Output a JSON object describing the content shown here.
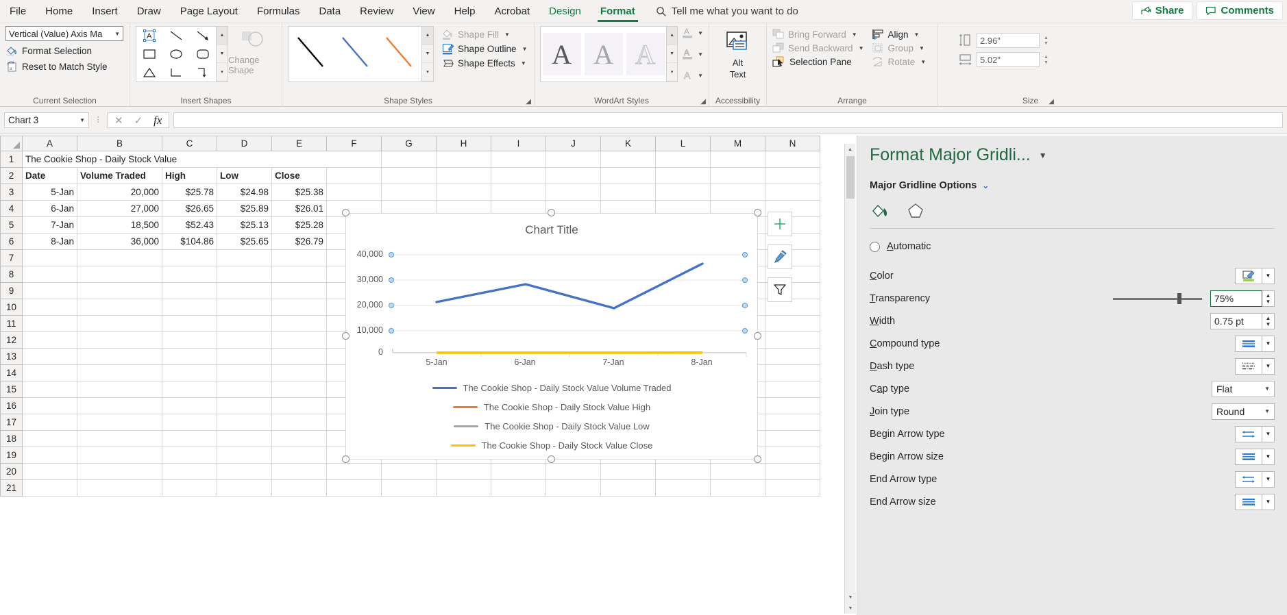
{
  "ribbon": {
    "tabs": [
      {
        "label": "File",
        "state": "normal"
      },
      {
        "label": "Home",
        "state": "normal"
      },
      {
        "label": "Insert",
        "state": "normal"
      },
      {
        "label": "Draw",
        "state": "normal"
      },
      {
        "label": "Page Layout",
        "state": "normal"
      },
      {
        "label": "Formulas",
        "state": "normal"
      },
      {
        "label": "Data",
        "state": "normal"
      },
      {
        "label": "Review",
        "state": "normal"
      },
      {
        "label": "View",
        "state": "normal"
      },
      {
        "label": "Help",
        "state": "normal"
      },
      {
        "label": "Acrobat",
        "state": "normal"
      },
      {
        "label": "Design",
        "state": "context"
      },
      {
        "label": "Format",
        "state": "active"
      }
    ],
    "tell_me": "Tell me what you want to do",
    "share": "Share",
    "comments": "Comments",
    "groups": {
      "current_selection": {
        "label": "Current Selection",
        "selection_value": "Vertical (Value) Axis Ma",
        "format_selection": "Format Selection",
        "reset_to_match_style": "Reset to Match Style"
      },
      "insert_shapes": {
        "label": "Insert Shapes",
        "change_shape": "Change Shape"
      },
      "shape_styles": {
        "label": "Shape Styles",
        "shape_fill": "Shape Fill",
        "shape_outline": "Shape Outline",
        "shape_effects": "Shape Effects"
      },
      "wordart_styles": {
        "label": "WordArt Styles",
        "sample": "A"
      },
      "accessibility": {
        "label": "Accessibility",
        "alt_text_line1": "Alt",
        "alt_text_line2": "Text"
      },
      "arrange": {
        "label": "Arrange",
        "bring_forward": "Bring Forward",
        "send_backward": "Send Backward",
        "selection_pane": "Selection Pane",
        "align": "Align",
        "group": "Group",
        "rotate": "Rotate"
      },
      "size": {
        "label": "Size",
        "height": "2.96\"",
        "width": "5.02\""
      }
    }
  },
  "formula_bar": {
    "name_box": "Chart 3",
    "formula_value": ""
  },
  "sheet": {
    "columns": [
      "A",
      "B",
      "C",
      "D",
      "E",
      "F",
      "G",
      "H",
      "I",
      "J",
      "K",
      "L",
      "M",
      "N"
    ],
    "rows": [
      "1",
      "2",
      "3",
      "4",
      "5",
      "6",
      "7",
      "8",
      "9",
      "10",
      "11",
      "12",
      "13",
      "14",
      "15",
      "16",
      "17",
      "18",
      "19",
      "20",
      "21"
    ],
    "title_cell": "The Cookie Shop - Daily Stock Value",
    "headers": [
      "Date",
      "Volume Traded",
      "High",
      "Low",
      "Close"
    ],
    "data": [
      [
        "5-Jan",
        "20,000",
        "$25.78",
        "$24.98",
        "$25.38"
      ],
      [
        "6-Jan",
        "27,000",
        "$26.65",
        "$25.89",
        "$26.01"
      ],
      [
        "7-Jan",
        "18,500",
        "$52.43",
        "$25.13",
        "$25.28"
      ],
      [
        "8-Jan",
        "36,000",
        "$104.86",
        "$25.65",
        "$26.79"
      ]
    ]
  },
  "chart_data": {
    "type": "line",
    "title": "Chart Title",
    "xlabel": "",
    "ylabel": "",
    "categories": [
      "5-Jan",
      "6-Jan",
      "7-Jan",
      "8-Jan"
    ],
    "yticks": [
      "0",
      "10,000",
      "20,000",
      "30,000",
      "40,000"
    ],
    "ylim": [
      0,
      40000
    ],
    "grid": true,
    "legend_position": "bottom",
    "series": [
      {
        "name": "The Cookie Shop - Daily Stock Value Volume Traded",
        "color": "#4472c4",
        "values": [
          20000,
          27000,
          18500,
          36000
        ]
      },
      {
        "name": "The Cookie Shop - Daily Stock Value High",
        "color": "#ed7d31",
        "values": [
          25.78,
          26.65,
          52.43,
          104.86
        ]
      },
      {
        "name": "The Cookie Shop - Daily Stock Value Low",
        "color": "#a5a5a5",
        "values": [
          24.98,
          25.89,
          25.13,
          25.65
        ]
      },
      {
        "name": "The Cookie Shop - Daily Stock Value Close",
        "color": "#ffc000",
        "values": [
          25.38,
          26.01,
          25.28,
          26.79
        ]
      }
    ]
  },
  "chart_side_buttons": [
    "chart-elements-plus",
    "chart-styles-brush",
    "chart-filter-funnel"
  ],
  "task_pane": {
    "title": "Format Major Gridli...",
    "section": "Major Gridline Options",
    "tabs": [
      "fill-line-icon",
      "effects-pentagon-icon"
    ],
    "automatic": "Automatic",
    "rows": [
      {
        "label": "Color",
        "control": "swatch"
      },
      {
        "label": "Transparency",
        "control": "slider-spin",
        "value": "75%"
      },
      {
        "label": "Width",
        "control": "spin",
        "value": "0.75 pt"
      },
      {
        "label": "Compound type",
        "control": "gallery"
      },
      {
        "label": "Dash type",
        "control": "gallery"
      },
      {
        "label": "Cap type",
        "control": "select",
        "value": "Flat"
      },
      {
        "label": "Join type",
        "control": "select",
        "value": "Round"
      },
      {
        "label": "Begin Arrow type",
        "control": "gallery"
      },
      {
        "label": "Begin Arrow size",
        "control": "gallery"
      },
      {
        "label": "End Arrow type",
        "control": "gallery"
      },
      {
        "label": "End Arrow size",
        "control": "gallery"
      }
    ]
  },
  "colors": {
    "accent_green": "#107c41",
    "series_blue": "#4472c4",
    "series_orange": "#ed7d31",
    "series_gray": "#a5a5a5",
    "series_yellow": "#ffc000"
  }
}
